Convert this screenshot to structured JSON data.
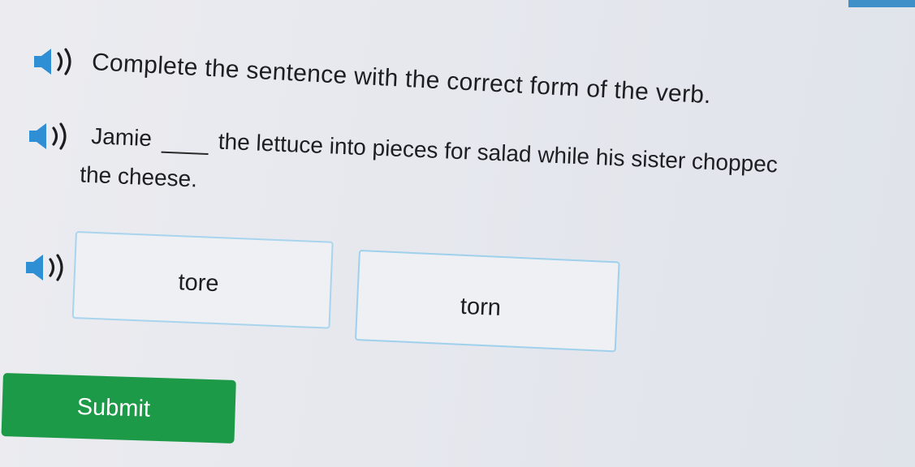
{
  "question": {
    "instruction": "Complete the sentence with the correct form of the verb.",
    "sentence_start": "Jamie",
    "sentence_after_blank": "the lettuce into pieces for salad while his sister choppec",
    "sentence_line2": "the cheese."
  },
  "choices": [
    {
      "label": "tore"
    },
    {
      "label": "torn"
    }
  ],
  "submit_label": "Submit",
  "icons": {
    "audio": "speaker-icon"
  },
  "colors": {
    "submit_bg": "#1c9a47",
    "choice_border": "#a8d4ee",
    "accent": "#3f8fc9",
    "speaker": "#2f8fd4"
  }
}
